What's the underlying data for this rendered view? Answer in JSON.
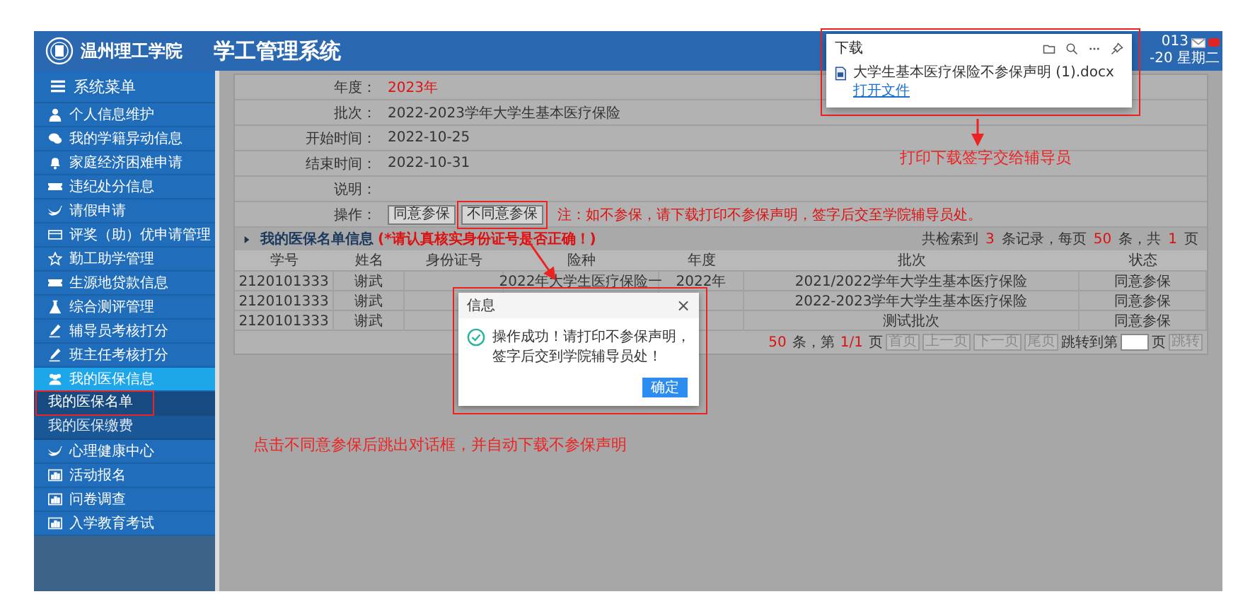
{
  "header": {
    "school": "温州理工学院",
    "title": "学工管理系统",
    "user_fragment": "013",
    "date_fragment": "-20 星期二"
  },
  "sidebar": {
    "title": "系统菜单",
    "items": [
      {
        "label": "个人信息维护",
        "selected": false
      },
      {
        "label": "我的学籍异动信息",
        "selected": false
      },
      {
        "label": "家庭经济困难申请",
        "selected": false
      },
      {
        "label": "违纪处分信息",
        "selected": false
      },
      {
        "label": "请假申请",
        "selected": false
      },
      {
        "label": "评奖（助）优申请管理",
        "selected": false
      },
      {
        "label": "勤工助学管理",
        "selected": false
      },
      {
        "label": "生源地贷款信息",
        "selected": false
      },
      {
        "label": "综合测评管理",
        "selected": false
      },
      {
        "label": "辅导员考核打分",
        "selected": false
      },
      {
        "label": "班主任考核打分",
        "selected": false
      },
      {
        "label": "我的医保信息",
        "selected": true,
        "children": [
          {
            "label": "我的医保名单",
            "selected": true
          },
          {
            "label": "我的医保缴费",
            "selected": false
          }
        ]
      },
      {
        "label": "心理健康中心",
        "selected": false
      },
      {
        "label": "活动报名",
        "selected": false
      },
      {
        "label": "问卷调查",
        "selected": false
      },
      {
        "label": "入学教育考试",
        "selected": false
      }
    ]
  },
  "form": {
    "rows": [
      {
        "label": "年度：",
        "value": "2023年",
        "kind": "highlight"
      },
      {
        "label": "批次：",
        "value": "2022-2023学年大学生基本医疗保险",
        "kind": "text"
      },
      {
        "label": "开始时间：",
        "value": "2022-10-25",
        "kind": "text"
      },
      {
        "label": "结束时间：",
        "value": "2022-10-31",
        "kind": "text"
      },
      {
        "label": "说明："
      }
    ],
    "action": {
      "label": "操作：",
      "buttons": [
        "同意参保",
        "不同意参保"
      ],
      "note": "注：如不参保，请下载打印不参保声明，签字后交至学院辅导员处。"
    }
  },
  "table": {
    "title": "我的医保名单信息",
    "note": "(*请认真核实身份证号是否正确！)",
    "summary": [
      {
        "text": "共检索到",
        "kind": "label"
      },
      {
        "text": "3",
        "kind": "number"
      },
      {
        "text": "条记录，每页",
        "kind": "label"
      },
      {
        "text": "50",
        "kind": "number"
      },
      {
        "text": "条，共",
        "kind": "label"
      },
      {
        "text": "1",
        "kind": "number"
      },
      {
        "text": "页",
        "kind": "label"
      }
    ],
    "columns": [
      "学号",
      "姓名",
      "身份证号",
      "险种",
      "年度",
      "批次",
      "状态"
    ],
    "rows": [
      {
        "cells": [
          "2120101333",
          "谢武",
          null,
          "2022年大学生医疗保险一",
          "2022年",
          "2021/2022学年大学生基本医疗保险",
          "同意参保"
        ]
      },
      {
        "cells": [
          "2120101333",
          "谢武",
          null,
          null,
          null,
          "2022-2023学年大学生基本医疗保险",
          "同意参保"
        ]
      },
      {
        "cells": [
          "2120101333",
          "谢武",
          null,
          null,
          null,
          "测试批次",
          "同意参保"
        ]
      }
    ],
    "pagination": {
      "parts": [
        {
          "text": "50",
          "kind": "number"
        },
        {
          "text": "条，第",
          "kind": "label"
        },
        {
          "text": "1/1",
          "kind": "number"
        },
        {
          "text": "页",
          "kind": "label"
        }
      ],
      "buttons": [
        {
          "label": "首页",
          "disabled": true
        },
        {
          "label": "上一页",
          "disabled": true
        },
        {
          "label": "下一页",
          "disabled": true
        },
        {
          "label": "尾页",
          "disabled": true
        }
      ],
      "jump_prefix": "跳转到第",
      "jump_suffix": "页",
      "jump_button": "跳转"
    }
  },
  "dialog": {
    "title": "信息",
    "close": "×",
    "message": "操作成功！请打印不参保声明，签字后交到学院辅导员处！",
    "button": "确定"
  },
  "download": {
    "title": "下载",
    "file": "大学生基本医疗保险不参保声明 (1).docx",
    "link": "打开文件"
  },
  "annotations": {
    "download_hint": "打印下载签字交给辅导员",
    "dialog_hint": "点击不同意参保后跳出对话框，并自动下载不参保声明"
  }
}
